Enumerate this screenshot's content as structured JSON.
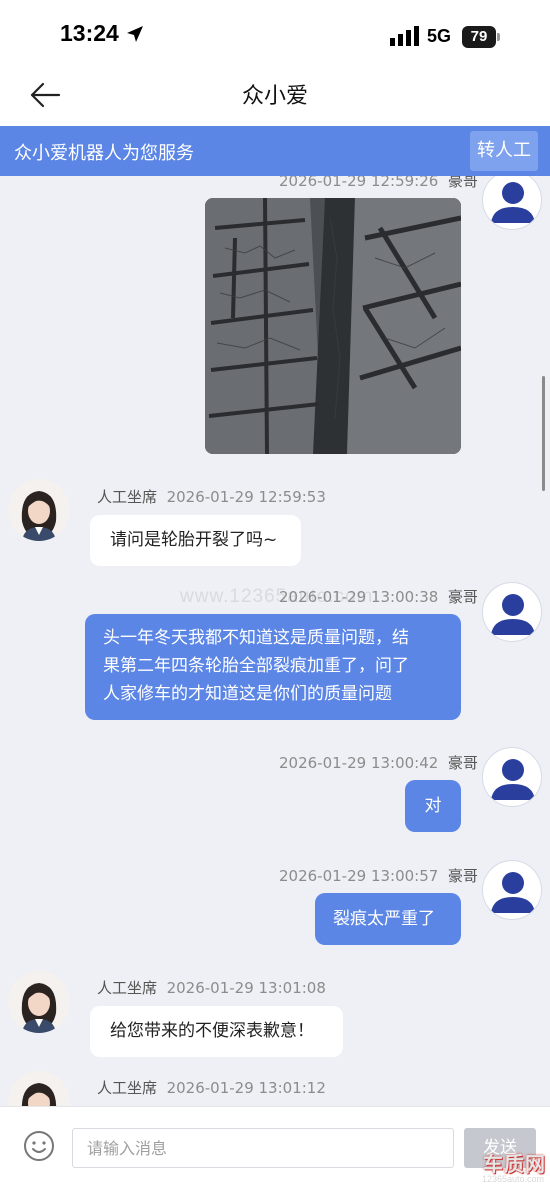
{
  "status_bar": {
    "time": "13:24",
    "network": "5G",
    "battery": "79"
  },
  "nav": {
    "title": "众小爱"
  },
  "banner": {
    "text": "众小爱机器人为您服务",
    "transfer_label": "转人工"
  },
  "messages": [
    {
      "side": "right",
      "name": "豪哥",
      "time": "2026-01-29 12:59:26",
      "type": "image",
      "image_desc": "tire-photo"
    },
    {
      "side": "left",
      "name": "人工坐席",
      "time": "2026-01-29 12:59:53",
      "text": "请问是轮胎开裂了吗~"
    },
    {
      "side": "right",
      "name": "豪哥",
      "time": "2026-01-29 13:00:38",
      "lines": [
        "头一年冬天我都不知道这是质量问题，结",
        "果第二年四条轮胎全部裂痕加重了，问了",
        "人家修车的才知道这是你们的质量问题"
      ]
    },
    {
      "side": "right",
      "name": "豪哥",
      "time": "2026-01-29 13:00:42",
      "text": "对"
    },
    {
      "side": "right",
      "name": "豪哥",
      "time": "2026-01-29 13:00:57",
      "text": "裂痕太严重了"
    },
    {
      "side": "left",
      "name": "人工坐席",
      "time": "2026-01-29 13:01:08",
      "text": "给您带来的不便深表歉意！"
    },
    {
      "side": "left",
      "name": "人工坐席",
      "time": "2026-01-29 13:01:12",
      "text": ""
    }
  ],
  "watermark": "www.12365auto.com",
  "input": {
    "placeholder": "请输入消息",
    "send_label": "发送"
  },
  "logo": {
    "main": "车质网",
    "sub": "12365auto.com"
  },
  "colors": {
    "accent": "#5b86e5",
    "chat_bg": "#eef0f5",
    "user_avatar": "#2a3f9d"
  }
}
